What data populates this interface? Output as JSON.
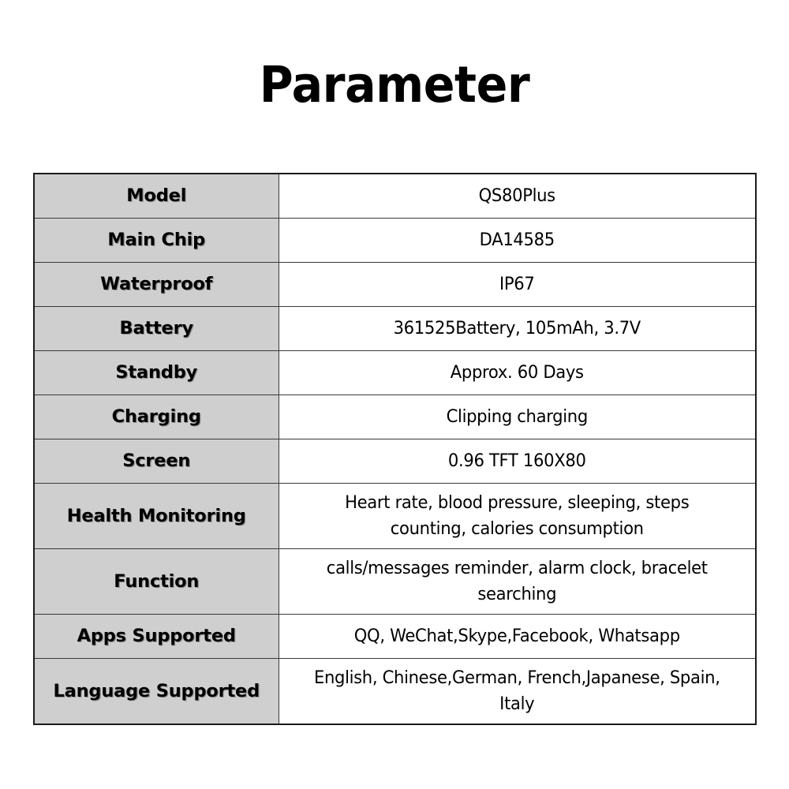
{
  "page": {
    "title": "Parameter",
    "background_color": "#ffffff",
    "label_cell_color": "#cfcfcf",
    "value_cell_color": "#ffffff",
    "border_color": "#3a3a3a",
    "text_color": "#000000"
  },
  "spec_table": {
    "rows": [
      {
        "label": "Model",
        "value": "QS80Plus",
        "lines": [
          "QS80Plus"
        ]
      },
      {
        "label": "Main Chip",
        "value": "DA14585",
        "lines": [
          "DA14585"
        ]
      },
      {
        "label": "Waterproof",
        "value": "IP67",
        "lines": [
          "IP67"
        ]
      },
      {
        "label": "Battery",
        "value": "361525Battery, 105mAh, 3.7V",
        "lines": [
          "361525Battery, 105mAh, 3.7V"
        ]
      },
      {
        "label": "Standby",
        "value": "Approx. 60 Days",
        "lines": [
          "Approx. 60 Days"
        ]
      },
      {
        "label": "Charging",
        "value": "Clipping charging",
        "lines": [
          "Clipping charging"
        ]
      },
      {
        "label": "Screen",
        "value": "0.96 TFT 160X80",
        "lines": [
          "0.96 TFT 160X80"
        ]
      },
      {
        "label": "Health Monitoring",
        "value": "Heart rate, blood pressure, sleeping, steps counting, calories consumption",
        "lines": [
          "Heart rate, blood pressure, sleeping, steps",
          "counting, calories consumption"
        ]
      },
      {
        "label": "Function",
        "value": "calls/messages reminder, alarm clock, bracelet searching",
        "lines": [
          "calls/messages reminder, alarm clock, bracelet",
          "searching"
        ]
      },
      {
        "label": "Apps Supported",
        "value": "QQ, WeChat,Skype,Facebook, Whatsapp",
        "lines": [
          "QQ, WeChat,Skype,Facebook, Whatsapp"
        ]
      },
      {
        "label": "Language Supported",
        "value": "English, Chinese,German, French,Japanese, Spain, Italy",
        "lines": [
          "English, Chinese,German, French,Japanese, Spain,",
          "Italy"
        ]
      }
    ]
  }
}
